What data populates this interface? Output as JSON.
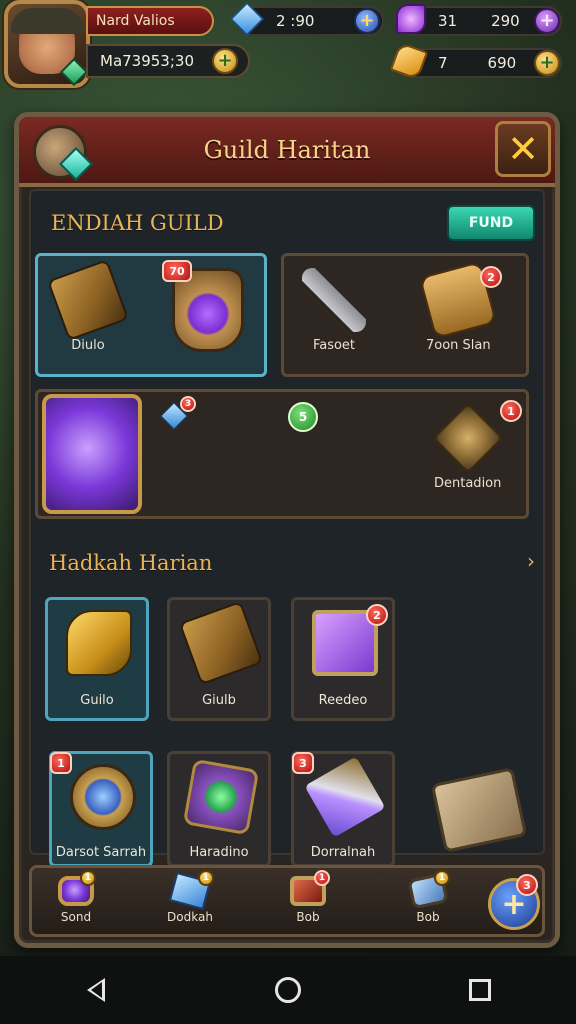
{
  "hud": {
    "player_name": "Nard Valios",
    "power_text": "Ma73953;30",
    "gems_blue": "2 :90",
    "gems_purple": "31",
    "gems_purple_total": "290",
    "gold_left": "7",
    "gold_right": "690",
    "plus_symbol": "+"
  },
  "panel": {
    "title": "Guild Haritan",
    "close_symbol": "✕"
  },
  "guild_section": {
    "title": "ENDIAH GUILD",
    "fund_button": "FUND",
    "row1_left_label": "Diulo",
    "row1_left_badge": "70",
    "row1_mid_label": "Fasoet",
    "row1_right_label": "7oon Slan",
    "row1_right_badge": "2",
    "row2_badge_a": "3",
    "row2_badge_b": "5",
    "row2_right_label": "Dentadion",
    "row2_right_badge": "1"
  },
  "harian_section": {
    "title": "Hadkah Harian",
    "chevron": "›",
    "tiles": [
      {
        "label": "Guilo",
        "badge": ""
      },
      {
        "label": "Giulb",
        "badge": ""
      },
      {
        "label": "Reedeo",
        "badge": "2"
      },
      {
        "label": "Darsot Sarrah",
        "badge": "1"
      },
      {
        "label": "Haradino",
        "badge": ""
      },
      {
        "label": "Dorralnah",
        "badge": "3"
      }
    ]
  },
  "bottom_bar": {
    "items": [
      {
        "label": "Sond",
        "badge": "1"
      },
      {
        "label": "Dodkah",
        "badge": "1"
      },
      {
        "label": "Bob",
        "badge": "1"
      },
      {
        "label": "Bob",
        "badge": "1"
      }
    ],
    "plus_badge": "3",
    "plus_symbol": "+"
  }
}
